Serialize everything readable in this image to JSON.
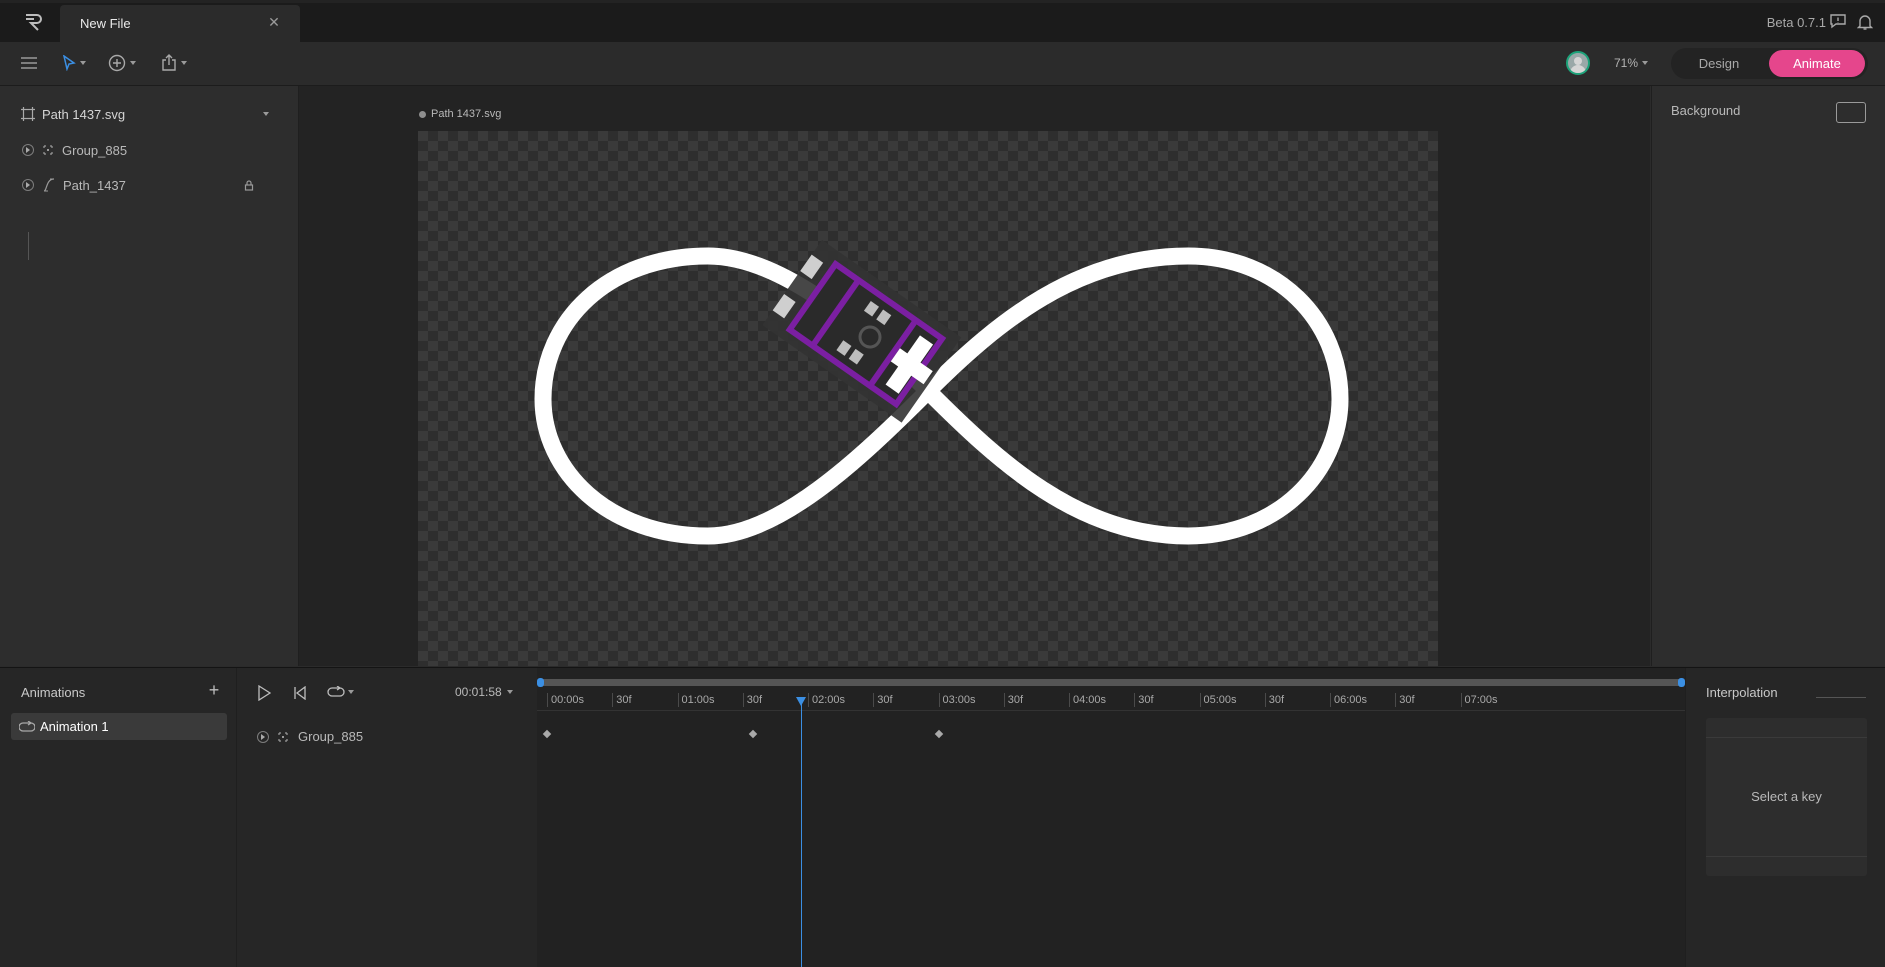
{
  "window": {
    "tab_title": "New File",
    "version": "Beta 0.7.1"
  },
  "toolbar": {
    "zoom": "71%",
    "mode_design": "Design",
    "mode_animate": "Animate",
    "active_mode": "Animate"
  },
  "hierarchy": {
    "artboard": "Path 1437.svg",
    "items": [
      {
        "label": "Group_885",
        "icon": "group-icon"
      },
      {
        "label": "Path_1437",
        "icon": "path-icon",
        "locked": true
      }
    ]
  },
  "stage": {
    "artboard_label": "Path 1437.svg"
  },
  "inspector": {
    "background_label": "Background"
  },
  "animations": {
    "title": "Animations",
    "items": [
      "Animation 1"
    ]
  },
  "timeline": {
    "time": "00:01:58",
    "track_name": "Group_885",
    "ruler": [
      "00:00s",
      "30f",
      "01:00s",
      "30f",
      "02:00s",
      "30f",
      "03:00s",
      "30f",
      "04:00s",
      "30f",
      "05:00s",
      "30f",
      "06:00s",
      "30f",
      "07:00s"
    ],
    "keyframe_times_s": [
      0,
      1.58,
      3.0
    ],
    "playhead_s": 1.95
  },
  "interpolation": {
    "title": "Interpolation",
    "empty": "Select a key"
  },
  "colors": {
    "accent": "#e5468c",
    "playhead": "#3b8fe3",
    "car_frame": "#7b1fa2"
  }
}
